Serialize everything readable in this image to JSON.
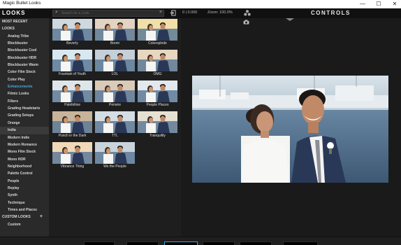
{
  "window": {
    "title": "Magic Bullet Looks",
    "minimize": "—",
    "maximize": "☐",
    "close": "✕"
  },
  "sidebar": {
    "header": "LOOKS",
    "items": [
      {
        "label": "MOST RECENT",
        "type": "cat"
      },
      {
        "label": "LOOKS",
        "type": "cat"
      },
      {
        "label": "Analog Tribe",
        "type": "item"
      },
      {
        "label": "Blockbuster",
        "type": "item"
      },
      {
        "label": "Blockbuster Cool",
        "type": "item"
      },
      {
        "label": "Blockbuster HDR",
        "type": "item"
      },
      {
        "label": "Blockbuster Warm",
        "type": "item"
      },
      {
        "label": "Color Film Stock",
        "type": "item"
      },
      {
        "label": "Color Play",
        "type": "item"
      },
      {
        "label": "Enhancements",
        "type": "item",
        "selected": true
      },
      {
        "label": "Filmic Looks",
        "type": "item"
      },
      {
        "label": "Filters",
        "type": "item"
      },
      {
        "label": "Grading Headstarts",
        "type": "item"
      },
      {
        "label": "Grading Setups",
        "type": "item"
      },
      {
        "label": "Orange",
        "type": "item"
      },
      {
        "label": "India",
        "type": "item",
        "highlight": true
      },
      {
        "label": "Modern Indie",
        "type": "item"
      },
      {
        "label": "Modern Romance",
        "type": "item"
      },
      {
        "label": "Mono Film Stock",
        "type": "item"
      },
      {
        "label": "Mono HDR",
        "type": "item"
      },
      {
        "label": "Neighborhood",
        "type": "item"
      },
      {
        "label": "Palette Control",
        "type": "item"
      },
      {
        "label": "People",
        "type": "item"
      },
      {
        "label": "Replay",
        "type": "item"
      },
      {
        "label": "Synth",
        "type": "item"
      },
      {
        "label": "Technique",
        "type": "item"
      },
      {
        "label": "Times and Places",
        "type": "item"
      },
      {
        "label": "CUSTOM LOOKS",
        "type": "cat",
        "plus": "+"
      },
      {
        "label": "Custom",
        "type": "item"
      }
    ]
  },
  "search": {
    "placeholder": "Search for a Look",
    "clear": "×",
    "icon": "search-icon"
  },
  "looks": [
    {
      "label": "Beverly"
    },
    {
      "label": "Boom"
    },
    {
      "label": "Colorsplode"
    },
    {
      "label": "Fountain of Youth"
    },
    {
      "label": "LOL"
    },
    {
      "label": "OMG"
    },
    {
      "label": "Palefellow"
    },
    {
      "label": "Pensée"
    },
    {
      "label": "People Places"
    },
    {
      "label": "Punch in the Dark"
    },
    {
      "label": "TTL"
    },
    {
      "label": "Tranquility"
    },
    {
      "label": "Vibrance Thing"
    },
    {
      "label": "We the People"
    }
  ],
  "preview": {
    "ruler": "0 | 0.000",
    "zoom": "Zoom: 100.0%",
    "controls_title": "CONTROLS"
  },
  "colors": {
    "accent": "#3fa8e6",
    "panel": "#1b1b1b",
    "sidebar": "#2a2a2a"
  }
}
